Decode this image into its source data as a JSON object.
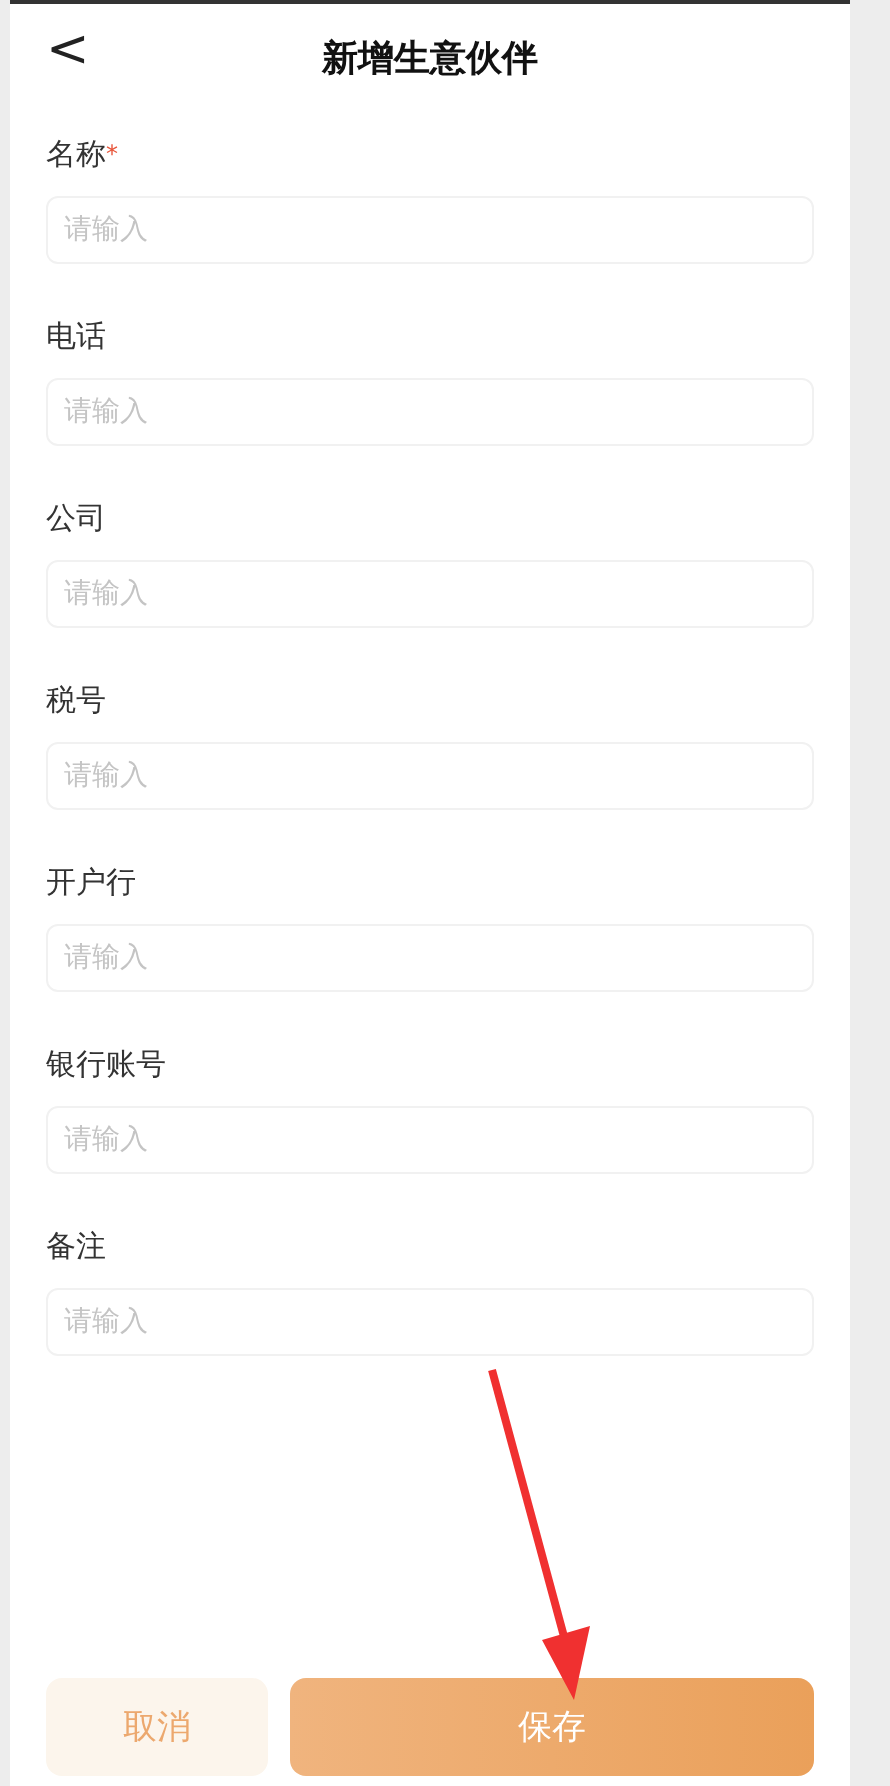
{
  "header": {
    "back": "<",
    "title": "新增生意伙伴"
  },
  "fields": [
    {
      "label": "名称",
      "required": true,
      "placeholder": "请输入"
    },
    {
      "label": "电话",
      "required": false,
      "placeholder": "请输入"
    },
    {
      "label": "公司",
      "required": false,
      "placeholder": "请输入"
    },
    {
      "label": "税号",
      "required": false,
      "placeholder": "请输入"
    },
    {
      "label": "开户行",
      "required": false,
      "placeholder": "请输入"
    },
    {
      "label": "银行账号",
      "required": false,
      "placeholder": "请输入"
    },
    {
      "label": "备注",
      "required": false,
      "placeholder": "请输入"
    }
  ],
  "required_mark": "*",
  "buttons": {
    "cancel": "取消",
    "save": "保存"
  }
}
